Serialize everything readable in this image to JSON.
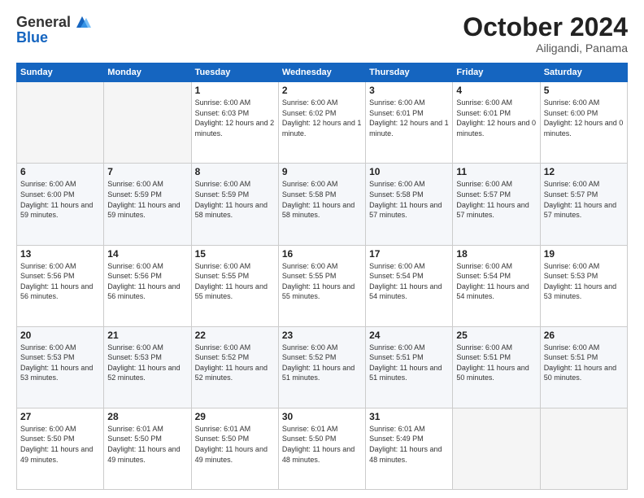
{
  "header": {
    "logo_line1": "General",
    "logo_line2": "Blue",
    "month_title": "October 2024",
    "location": "Ailigandi, Panama"
  },
  "weekdays": [
    "Sunday",
    "Monday",
    "Tuesday",
    "Wednesday",
    "Thursday",
    "Friday",
    "Saturday"
  ],
  "weeks": [
    [
      {
        "day": "",
        "empty": true
      },
      {
        "day": "",
        "empty": true
      },
      {
        "day": "1",
        "sunrise": "Sunrise: 6:00 AM",
        "sunset": "Sunset: 6:03 PM",
        "daylight": "Daylight: 12 hours and 2 minutes."
      },
      {
        "day": "2",
        "sunrise": "Sunrise: 6:00 AM",
        "sunset": "Sunset: 6:02 PM",
        "daylight": "Daylight: 12 hours and 1 minute."
      },
      {
        "day": "3",
        "sunrise": "Sunrise: 6:00 AM",
        "sunset": "Sunset: 6:01 PM",
        "daylight": "Daylight: 12 hours and 1 minute."
      },
      {
        "day": "4",
        "sunrise": "Sunrise: 6:00 AM",
        "sunset": "Sunset: 6:01 PM",
        "daylight": "Daylight: 12 hours and 0 minutes."
      },
      {
        "day": "5",
        "sunrise": "Sunrise: 6:00 AM",
        "sunset": "Sunset: 6:00 PM",
        "daylight": "Daylight: 12 hours and 0 minutes."
      }
    ],
    [
      {
        "day": "6",
        "sunrise": "Sunrise: 6:00 AM",
        "sunset": "Sunset: 6:00 PM",
        "daylight": "Daylight: 11 hours and 59 minutes."
      },
      {
        "day": "7",
        "sunrise": "Sunrise: 6:00 AM",
        "sunset": "Sunset: 5:59 PM",
        "daylight": "Daylight: 11 hours and 59 minutes."
      },
      {
        "day": "8",
        "sunrise": "Sunrise: 6:00 AM",
        "sunset": "Sunset: 5:59 PM",
        "daylight": "Daylight: 11 hours and 58 minutes."
      },
      {
        "day": "9",
        "sunrise": "Sunrise: 6:00 AM",
        "sunset": "Sunset: 5:58 PM",
        "daylight": "Daylight: 11 hours and 58 minutes."
      },
      {
        "day": "10",
        "sunrise": "Sunrise: 6:00 AM",
        "sunset": "Sunset: 5:58 PM",
        "daylight": "Daylight: 11 hours and 57 minutes."
      },
      {
        "day": "11",
        "sunrise": "Sunrise: 6:00 AM",
        "sunset": "Sunset: 5:57 PM",
        "daylight": "Daylight: 11 hours and 57 minutes."
      },
      {
        "day": "12",
        "sunrise": "Sunrise: 6:00 AM",
        "sunset": "Sunset: 5:57 PM",
        "daylight": "Daylight: 11 hours and 57 minutes."
      }
    ],
    [
      {
        "day": "13",
        "sunrise": "Sunrise: 6:00 AM",
        "sunset": "Sunset: 5:56 PM",
        "daylight": "Daylight: 11 hours and 56 minutes."
      },
      {
        "day": "14",
        "sunrise": "Sunrise: 6:00 AM",
        "sunset": "Sunset: 5:56 PM",
        "daylight": "Daylight: 11 hours and 56 minutes."
      },
      {
        "day": "15",
        "sunrise": "Sunrise: 6:00 AM",
        "sunset": "Sunset: 5:55 PM",
        "daylight": "Daylight: 11 hours and 55 minutes."
      },
      {
        "day": "16",
        "sunrise": "Sunrise: 6:00 AM",
        "sunset": "Sunset: 5:55 PM",
        "daylight": "Daylight: 11 hours and 55 minutes."
      },
      {
        "day": "17",
        "sunrise": "Sunrise: 6:00 AM",
        "sunset": "Sunset: 5:54 PM",
        "daylight": "Daylight: 11 hours and 54 minutes."
      },
      {
        "day": "18",
        "sunrise": "Sunrise: 6:00 AM",
        "sunset": "Sunset: 5:54 PM",
        "daylight": "Daylight: 11 hours and 54 minutes."
      },
      {
        "day": "19",
        "sunrise": "Sunrise: 6:00 AM",
        "sunset": "Sunset: 5:53 PM",
        "daylight": "Daylight: 11 hours and 53 minutes."
      }
    ],
    [
      {
        "day": "20",
        "sunrise": "Sunrise: 6:00 AM",
        "sunset": "Sunset: 5:53 PM",
        "daylight": "Daylight: 11 hours and 53 minutes."
      },
      {
        "day": "21",
        "sunrise": "Sunrise: 6:00 AM",
        "sunset": "Sunset: 5:53 PM",
        "daylight": "Daylight: 11 hours and 52 minutes."
      },
      {
        "day": "22",
        "sunrise": "Sunrise: 6:00 AM",
        "sunset": "Sunset: 5:52 PM",
        "daylight": "Daylight: 11 hours and 52 minutes."
      },
      {
        "day": "23",
        "sunrise": "Sunrise: 6:00 AM",
        "sunset": "Sunset: 5:52 PM",
        "daylight": "Daylight: 11 hours and 51 minutes."
      },
      {
        "day": "24",
        "sunrise": "Sunrise: 6:00 AM",
        "sunset": "Sunset: 5:51 PM",
        "daylight": "Daylight: 11 hours and 51 minutes."
      },
      {
        "day": "25",
        "sunrise": "Sunrise: 6:00 AM",
        "sunset": "Sunset: 5:51 PM",
        "daylight": "Daylight: 11 hours and 50 minutes."
      },
      {
        "day": "26",
        "sunrise": "Sunrise: 6:00 AM",
        "sunset": "Sunset: 5:51 PM",
        "daylight": "Daylight: 11 hours and 50 minutes."
      }
    ],
    [
      {
        "day": "27",
        "sunrise": "Sunrise: 6:00 AM",
        "sunset": "Sunset: 5:50 PM",
        "daylight": "Daylight: 11 hours and 49 minutes."
      },
      {
        "day": "28",
        "sunrise": "Sunrise: 6:01 AM",
        "sunset": "Sunset: 5:50 PM",
        "daylight": "Daylight: 11 hours and 49 minutes."
      },
      {
        "day": "29",
        "sunrise": "Sunrise: 6:01 AM",
        "sunset": "Sunset: 5:50 PM",
        "daylight": "Daylight: 11 hours and 49 minutes."
      },
      {
        "day": "30",
        "sunrise": "Sunrise: 6:01 AM",
        "sunset": "Sunset: 5:50 PM",
        "daylight": "Daylight: 11 hours and 48 minutes."
      },
      {
        "day": "31",
        "sunrise": "Sunrise: 6:01 AM",
        "sunset": "Sunset: 5:49 PM",
        "daylight": "Daylight: 11 hours and 48 minutes."
      },
      {
        "day": "",
        "empty": true
      },
      {
        "day": "",
        "empty": true
      }
    ]
  ]
}
